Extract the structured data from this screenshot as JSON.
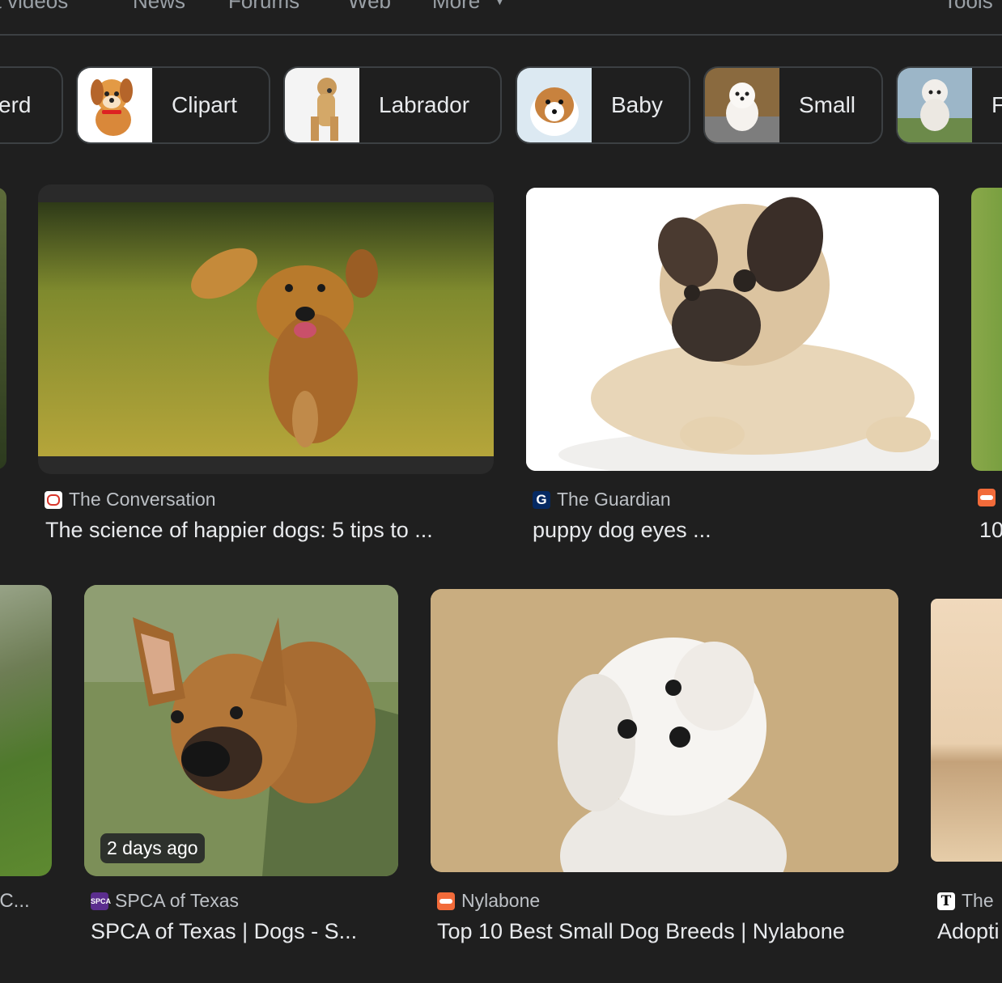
{
  "nav": {
    "items": [
      "rt videos",
      "News",
      "Forums",
      "Web",
      "More"
    ],
    "more_chevron": "chevron-down-icon",
    "tools": "Tools"
  },
  "chips": [
    {
      "label": "erd"
    },
    {
      "label": "Clipart"
    },
    {
      "label": "Labrador"
    },
    {
      "label": "Baby"
    },
    {
      "label": "Small"
    },
    {
      "label": "F"
    }
  ],
  "row1": [
    {
      "source": "The Conversation",
      "title": "The science of happier dogs: 5 tips to ...",
      "accent": "#d8352a"
    },
    {
      "source": "The Guardian",
      "title": "puppy dog eyes ...",
      "accent": "#052962"
    },
    {
      "source": "",
      "title": "10",
      "accent": "#f26b3a"
    }
  ],
  "row2": [
    {
      "source": "",
      "title": "f C...",
      "accent": "#888888"
    },
    {
      "source": "SPCA of Texas",
      "title": "SPCA of Texas | Dogs - S...",
      "badge": "2 days ago",
      "accent": "#5b2d8e"
    },
    {
      "source": "Nylabone",
      "title": "Top 10 Best Small Dog Breeds | Nylabone",
      "accent": "#f26b3a"
    },
    {
      "source": "The",
      "title": "Adopti",
      "accent": "#ffffff"
    }
  ],
  "colors": {
    "background": "#1f1f1f",
    "chip_border": "#3c4043",
    "text_primary": "#e8eaed",
    "text_secondary": "#bdc1c6"
  }
}
